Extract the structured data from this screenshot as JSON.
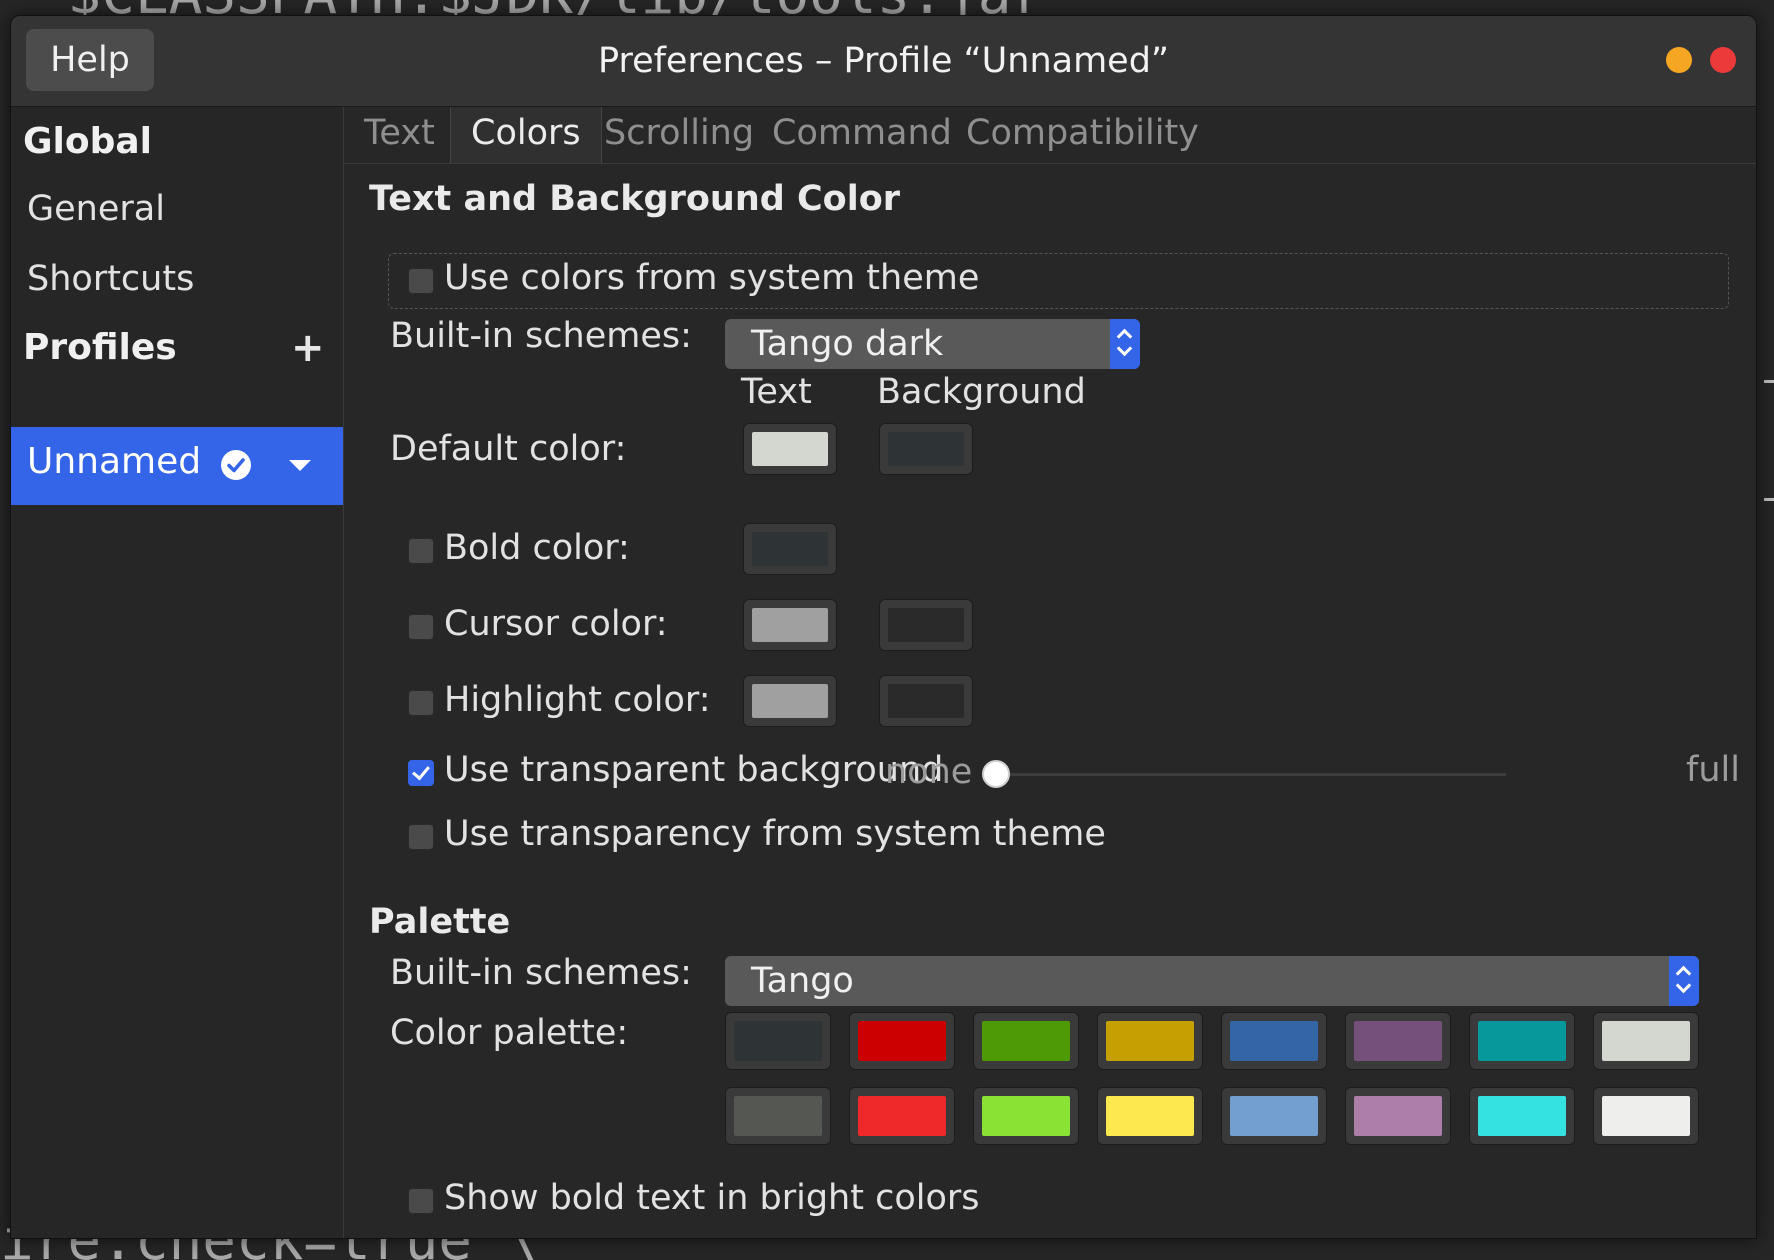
{
  "background_terminal": {
    "top_line": "  $CLASSPATH:$JDK/lib/tools.jar",
    "bottom_line": "ire.check=true \\"
  },
  "window": {
    "title": "Preferences – Profile “Unnamed”",
    "help_label": "Help",
    "controls": {
      "minimize_color": "#f5a623",
      "close_color": "#ec3a3a"
    }
  },
  "sidebar": {
    "global_header": "Global",
    "general_label": "General",
    "shortcuts_label": "Shortcuts",
    "profiles_header": "Profiles",
    "add_profile_glyph": "+",
    "selected_profile": "Unnamed",
    "accent_color": "#3465e8"
  },
  "tabs": {
    "text": "Text",
    "colors": "Colors",
    "scrolling": "Scrolling",
    "command": "Command",
    "compatibility": "Compatibility",
    "active": "Colors"
  },
  "text_bg": {
    "section_title": "Text and Background Color",
    "use_system_colors": {
      "label": "Use colors from system theme",
      "checked": false
    },
    "builtin_label": "Built-in schemes:",
    "builtin_value": "Tango dark",
    "col_text": "Text",
    "col_background": "Background",
    "default_label": "Default color:",
    "default_text_color": "#d3d7cf",
    "default_bg_color": "#2e3436",
    "bold": {
      "label": "Bold color:",
      "checked": false,
      "color": "#2e3436"
    },
    "cursor": {
      "label": "Cursor color:",
      "checked": false,
      "text_color": "#a0a0a0",
      "bg_color": "#2a2a2a"
    },
    "highlight": {
      "label": "Highlight color:",
      "checked": false,
      "text_color": "#a0a0a0",
      "bg_color": "#2a2a2a"
    },
    "transparent_bg": {
      "label": "Use transparent background",
      "checked": true,
      "min_label": "none",
      "max_label": "full",
      "level": 0.0
    },
    "transparency_system": {
      "label": "Use transparency from system theme",
      "checked": false
    }
  },
  "palette": {
    "section_title": "Palette",
    "builtin_label": "Built-in schemes:",
    "builtin_value": "Tango",
    "color_palette_label": "Color palette:",
    "colors": [
      "#2e3436",
      "#cc0000",
      "#4e9a06",
      "#c4a000",
      "#3465a4",
      "#75507b",
      "#06989a",
      "#d3d7cf",
      "#555753",
      "#ef2929",
      "#8ae234",
      "#fce94f",
      "#729fcf",
      "#ad7fa8",
      "#34e2e2",
      "#eeeeec"
    ],
    "show_bold_bright": {
      "label": "Show bold text in bright colors",
      "checked": false
    }
  }
}
